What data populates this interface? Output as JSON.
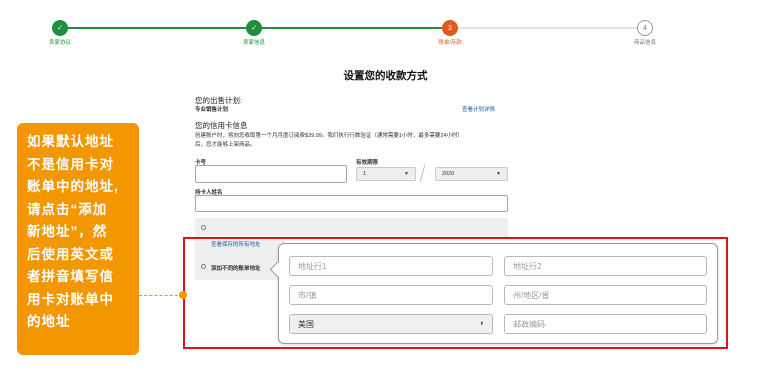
{
  "steps": [
    {
      "label": "卖家协议",
      "num": "✓",
      "status": "done"
    },
    {
      "label": "卖家信息",
      "num": "✓",
      "status": "done"
    },
    {
      "label": "账单/存款",
      "num": "3",
      "status": "current"
    },
    {
      "label": "商品信息",
      "num": "4",
      "status": "todo"
    }
  ],
  "page_title": "设置您的收款方式",
  "plan": {
    "heading": "您的出售计划:",
    "name": "专业销售计划",
    "link": "查看计划详情"
  },
  "card": {
    "heading": "您的信用卡信息",
    "desc_line1": "创建账户时，将向您收取第一个月月度订阅费$39.99。我们执行行数验证（通常需要1小时，最多需要24小时）",
    "desc_line2": "后，您才能够上架商品。",
    "number_label": "卡号",
    "expiry_label": "有效期限",
    "month_value": "1",
    "year_value": "2020",
    "holder_label": "持卡人姓名"
  },
  "address": {
    "saved_link": "查看保存的所有地址",
    "different_label": "添加不同的账单地址",
    "line1_placeholder": "地址行1",
    "line2_placeholder": "地址行2",
    "city_placeholder": "市/镇",
    "state_placeholder": "州/地区/省",
    "country_value": "美国",
    "zip_placeholder": "邮政编码"
  },
  "callout": {
    "lines": [
      "如果默认地址",
      "不是信用卡对",
      "账单中的地址,",
      "请点击“添加",
      "新地址”，然",
      "后使用英文或",
      "者拼音填写信",
      "用卡对账单中",
      "的地址"
    ]
  },
  "colors": {
    "step_done": "#1f8f3d",
    "step_current": "#e05a1e",
    "highlight_frame": "#e3101a",
    "callout_bg": "#f39700",
    "link": "#1a5aa8"
  }
}
